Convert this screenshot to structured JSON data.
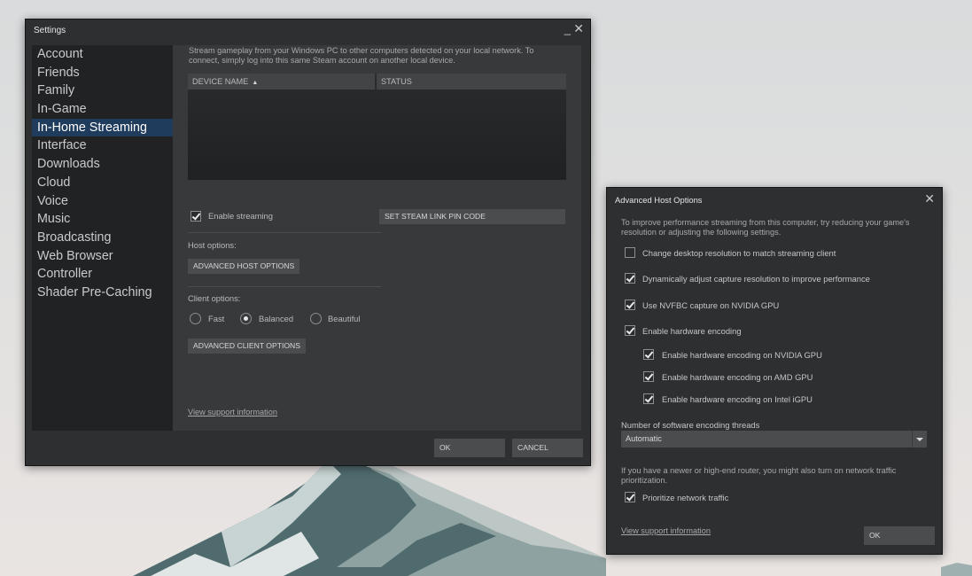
{
  "settings": {
    "title": "Settings",
    "minimize_glyph": "_",
    "close_glyph": "✕",
    "sidebar": [
      {
        "label": "Account"
      },
      {
        "label": "Friends"
      },
      {
        "label": "Family"
      },
      {
        "label": "In-Game"
      },
      {
        "label": "In-Home Streaming",
        "active": true
      },
      {
        "label": "Interface"
      },
      {
        "label": "Downloads"
      },
      {
        "label": "Cloud"
      },
      {
        "label": "Voice"
      },
      {
        "label": "Music"
      },
      {
        "label": "Broadcasting"
      },
      {
        "label": "Web Browser"
      },
      {
        "label": "Controller"
      },
      {
        "label": "Shader Pre-Caching"
      }
    ],
    "description": "Stream gameplay from your Windows PC to other computers detected on your local network. To connect, simply log into this same Steam account on another local device.",
    "table": {
      "col_device": "DEVICE NAME",
      "col_status": "STATUS",
      "sort_indicator": "▲"
    },
    "enable_streaming": {
      "label": "Enable streaming",
      "checked": true
    },
    "pin_button": "SET STEAM LINK PIN CODE",
    "host_options_label": "Host options:",
    "advanced_host_button": "ADVANCED HOST OPTIONS",
    "client_options_label": "Client options:",
    "client_options": [
      {
        "label": "Fast",
        "selected": false
      },
      {
        "label": "Balanced",
        "selected": true
      },
      {
        "label": "Beautiful",
        "selected": false
      }
    ],
    "advanced_client_button": "ADVANCED CLIENT OPTIONS",
    "support_link": "View support information",
    "ok_button": "OK",
    "cancel_button": "CANCEL"
  },
  "host_dialog": {
    "title": "Advanced Host Options",
    "close_glyph": "✕",
    "description": "To improve performance streaming from this computer, try reducing your game's resolution or adjusting the following settings.",
    "options": [
      {
        "label": "Change desktop resolution to match streaming client",
        "checked": false
      },
      {
        "label": "Dynamically adjust capture resolution to improve performance",
        "checked": true
      },
      {
        "label": "Use NVFBC capture on NVIDIA GPU",
        "checked": true
      },
      {
        "label": "Enable hardware encoding",
        "checked": true
      }
    ],
    "hw_options": [
      {
        "label": "Enable hardware encoding on NVIDIA GPU",
        "checked": true
      },
      {
        "label": "Enable hardware encoding on AMD GPU",
        "checked": true
      },
      {
        "label": "Enable hardware encoding on Intel iGPU",
        "checked": true
      }
    ],
    "threads_label": "Number of software encoding threads",
    "threads_value": "Automatic",
    "router_note": "If you have a newer or high-end router, you might also turn on network traffic prioritization.",
    "prioritize": {
      "label": "Prioritize network traffic",
      "checked": true
    },
    "support_link": "View support information",
    "ok_button": "OK"
  },
  "colors": {
    "window_bg": "#2e2f31",
    "sidebar_bg": "#212224",
    "active_item_bg": "#1f3c5c",
    "button_bg": "#4b4c4e"
  }
}
